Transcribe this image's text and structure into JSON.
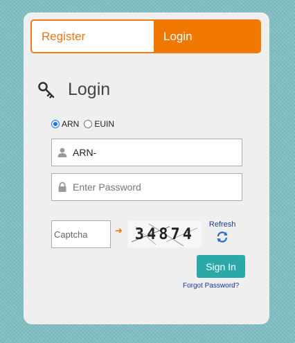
{
  "tabs": {
    "register_label": "Register",
    "login_label": "Login"
  },
  "heading": {
    "icon": "key-icon",
    "title": "Login"
  },
  "id_type": {
    "options": [
      "ARN",
      "EUIN"
    ],
    "selected": "ARN"
  },
  "arn_field": {
    "icon": "user-icon",
    "value": "ARN-"
  },
  "password_field": {
    "icon": "lock-icon",
    "placeholder": "Enter Password"
  },
  "captcha": {
    "placeholder": "Captcha",
    "image_text": "34874",
    "refresh_label": "Refresh",
    "refresh_icon": "refresh-icon"
  },
  "actions": {
    "sign_in_label": "Sign In",
    "forgot_password_label": "Forgot Password?"
  },
  "colors": {
    "accent": "#f07800",
    "button": "#2aa9a8",
    "link": "#1a2fa0"
  }
}
